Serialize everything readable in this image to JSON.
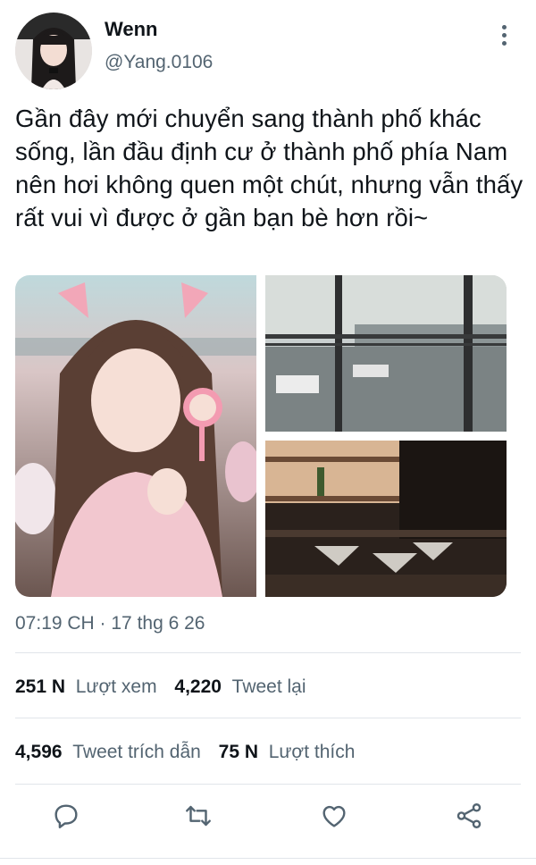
{
  "author": {
    "name": "Wenn",
    "handle": "@Yang.0106"
  },
  "tweet": {
    "text": "Gần đây mới chuyển sang thành phố khác sống, lần đầu định cư ở thành phố phía Nam nên hơi không quen một chút, nhưng vẫn thấy rất vui vì được ở gần bạn bè hơn rồi~",
    "timestamp": "07:19 CH · 17 thg 6 26"
  },
  "stats": {
    "views_count": "251 N",
    "views_label": "Lượt xem",
    "retweets_count": "4,220",
    "retweets_label": "Tweet lại",
    "quotes_count": "4,596",
    "quotes_label": "Tweet trích dẫn",
    "likes_count": "75 N",
    "likes_label": "Lượt thích"
  },
  "icons": [
    "more-vertical-icon",
    "reply-icon",
    "retweet-icon",
    "like-icon",
    "share-icon"
  ],
  "colors": {
    "text": "#0f1419",
    "secondary": "#536471",
    "divider": "#e1e5ea"
  }
}
